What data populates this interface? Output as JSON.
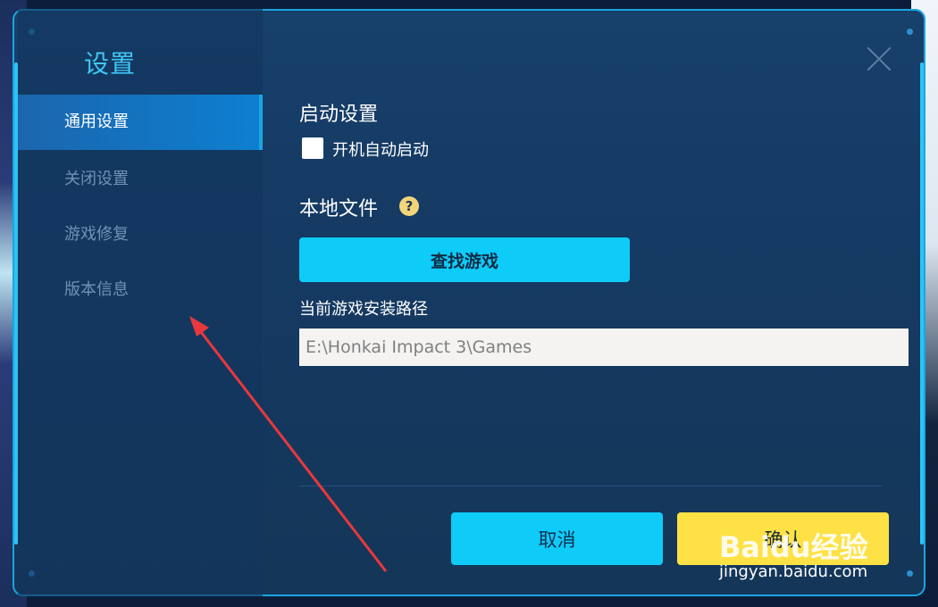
{
  "dialog": {
    "title": "设置"
  },
  "sidebar": {
    "items": [
      {
        "label": "通用设置",
        "active": true
      },
      {
        "label": "关闭设置",
        "active": false
      },
      {
        "label": "游戏修复",
        "active": false
      },
      {
        "label": "版本信息",
        "active": false
      }
    ]
  },
  "startup": {
    "title": "启动设置",
    "autostart_label": "开机自动启动",
    "autostart_checked": false
  },
  "local_files": {
    "title": "本地文件",
    "help_icon": "?",
    "find_button": "查找游戏",
    "path_label": "当前游戏安装路径",
    "path_value": "E:\\Honkai Impact 3\\Games"
  },
  "footer": {
    "cancel_label": "取消",
    "confirm_label": "确认"
  },
  "watermark": {
    "brand": "Baidu经验",
    "url": "jingyan.baidu.com"
  },
  "colors": {
    "accent": "#0ecbf8",
    "confirm": "#fee144",
    "active_nav": "#0d7fd1",
    "annotation_arrow": "#e8383d"
  }
}
